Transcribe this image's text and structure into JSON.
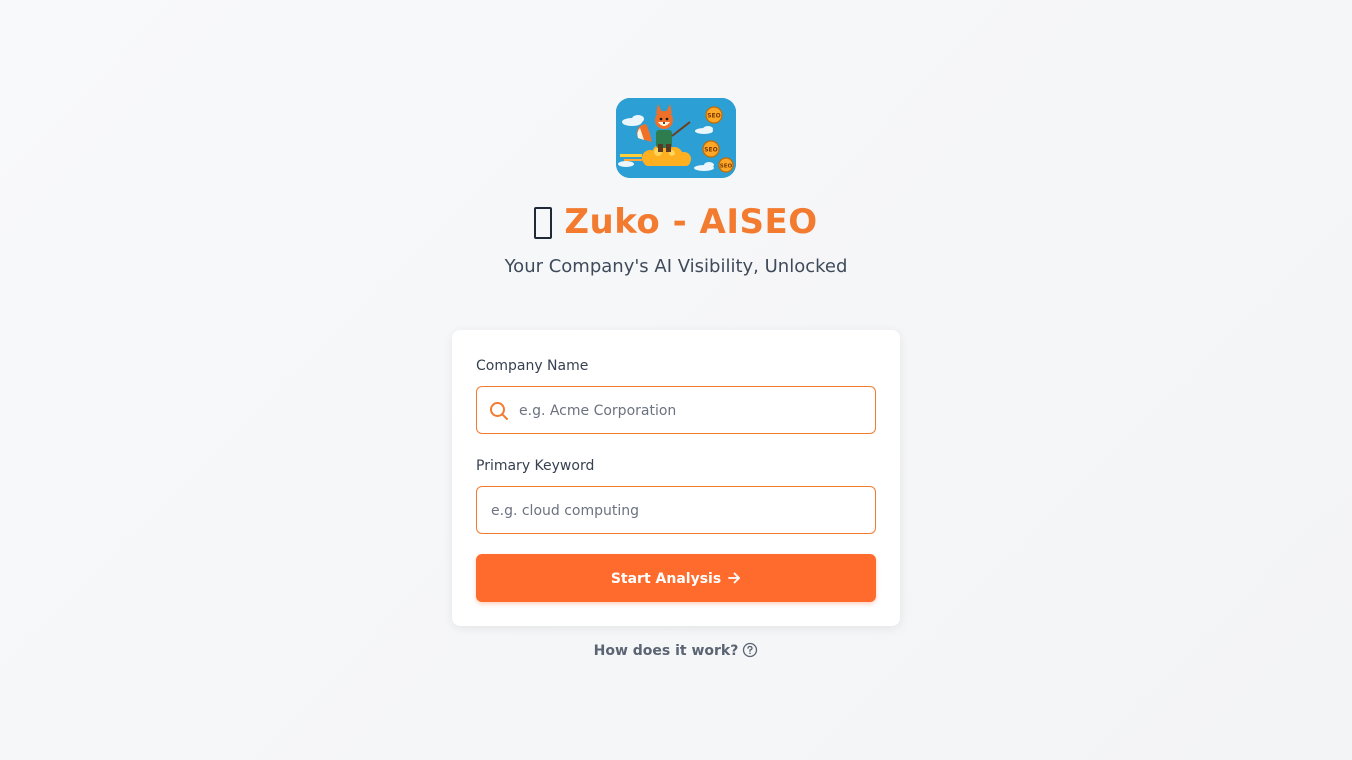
{
  "header": {
    "logo_icon": "fox-on-cloud-logo",
    "logo_badges": [
      "SEO",
      "SEO",
      "SEO"
    ],
    "title_glyph": "missing-glyph-icon",
    "title": "Zuko - AISEO",
    "subtitle": "Your Company's AI Visibility, Unlocked"
  },
  "form": {
    "company": {
      "label": "Company Name",
      "value": "",
      "placeholder": "e.g. Acme Corporation",
      "icon": "search-icon"
    },
    "keyword": {
      "label": "Primary Keyword",
      "value": "",
      "placeholder": "e.g. cloud computing"
    },
    "submit": {
      "label": "Start Analysis",
      "icon": "arrow-right-icon"
    }
  },
  "help": {
    "label": "How does it work?",
    "icon": "question-circle-icon"
  },
  "colors": {
    "accent": "#ff6b2c",
    "title": "#f37b30",
    "background": "#f5f6f8",
    "card": "#ffffff"
  }
}
